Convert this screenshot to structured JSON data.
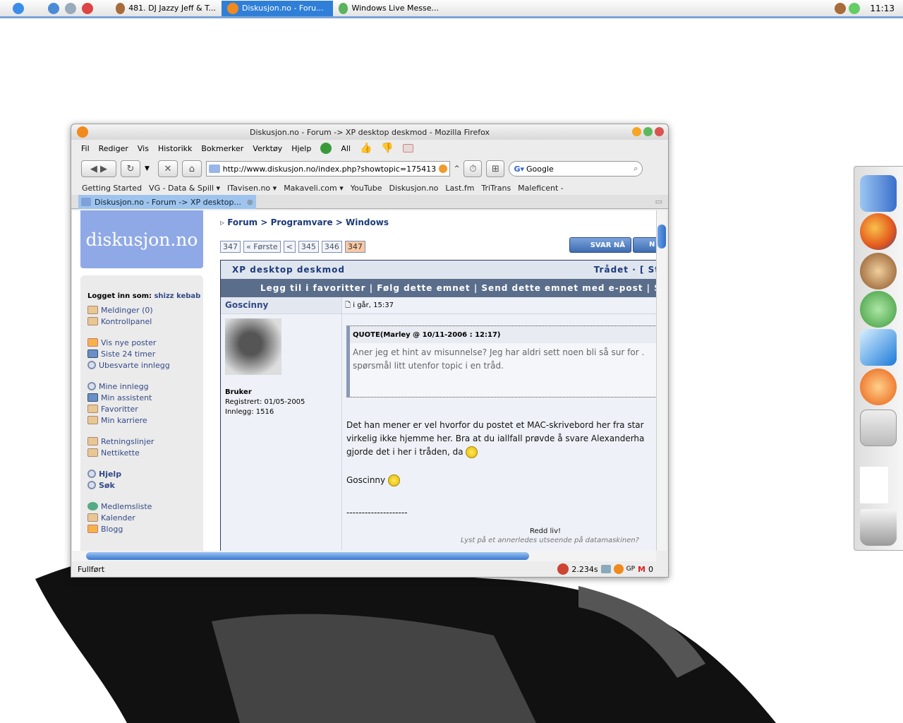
{
  "taskbar": {
    "tasks": [
      {
        "label": "481. DJ Jazzy Jeff & T..."
      },
      {
        "label": "Diskusjon.no - Foru..."
      },
      {
        "label": "Windows Live Messe..."
      }
    ],
    "clock": "11:13"
  },
  "window": {
    "title": "Diskusjon.no - Forum -> XP desktop deskmod - Mozilla Firefox",
    "menu": [
      "Fil",
      "Rediger",
      "Vis",
      "Historikk",
      "Bokmerker",
      "Verktøy",
      "Hjelp"
    ],
    "menu_all": "All",
    "url": "http://www.diskusjon.no/index.php?showtopic=175413",
    "search_placeholder": "Google",
    "bookmarks": [
      "Getting Started",
      "VG - Data & Spill ▾",
      "ITavisen.no ▾",
      "Makaveli.com ▾",
      "YouTube",
      "Diskusjon.no",
      "Last.fm",
      "TriTrans",
      "Maleficent -"
    ],
    "tab_label": "Diskusjon.no - Forum -> XP desktop...",
    "status": "Fullført",
    "status_time": "2.234s",
    "status_gp": "GP",
    "status_mail_count": "0"
  },
  "page": {
    "logo": "diskusjon.no",
    "logged_in_label": "Logget inn som:",
    "logged_in_user": "shizz kebab",
    "side_groups": [
      [
        {
          "label": "Meldinger (0)",
          "icon": "book"
        },
        {
          "label": "Kontrollpanel",
          "icon": "book"
        }
      ],
      [
        {
          "label": "Vis nye poster",
          "icon": "mail"
        },
        {
          "label": "Siste 24 timer",
          "icon": "cal"
        },
        {
          "label": "Ubesvarte innlegg",
          "icon": "mag"
        }
      ],
      [
        {
          "label": "Mine innlegg",
          "icon": "mag"
        },
        {
          "label": "Min assistent",
          "icon": "cal"
        },
        {
          "label": "Favoritter",
          "icon": "book"
        },
        {
          "label": "Min karriere",
          "icon": "book"
        }
      ],
      [
        {
          "label": "Retningslinjer",
          "icon": "book"
        },
        {
          "label": "Nettikette",
          "icon": "book"
        }
      ],
      [
        {
          "label": "Hjelp",
          "icon": "mag",
          "bold": true
        },
        {
          "label": "Søk",
          "icon": "mag",
          "bold": true
        }
      ],
      [
        {
          "label": "Medlemsliste",
          "icon": "users"
        },
        {
          "label": "Kalender",
          "icon": "book"
        },
        {
          "label": "Blogg",
          "icon": "mail"
        }
      ]
    ],
    "breadcrumb": [
      "Forum",
      "Programvare",
      "Windows"
    ],
    "pager": [
      "347",
      "« Første",
      "<",
      "345",
      "346",
      "347"
    ],
    "reply_button": "SVAR NÅ",
    "new_button": "N",
    "thread_title": "XP desktop deskmod",
    "thread_right": "Trådet · [ St",
    "thread_actions": "Legg til i favoritter | Følg dette emnet | Send dette emnet med e-post | Sk",
    "post": {
      "author": "Goscinny",
      "date": "i går, 15:37",
      "rank": "Bruker",
      "registered": "Registrert: 01/05-2005",
      "posts": "Innlegg: 1516",
      "quote_header": "QUOTE(Marley @ 10/11-2006 : 12:17)",
      "quote_lines": [
        "Aner jeg et hint av misunnelse? Jeg har aldri sett noen bli så sur for .",
        "spørsmål litt utenfor topic i en tråd."
      ],
      "body_lines": [
        "Det han mener er vel hvorfor du postet et MAC-skrivebord her fra star",
        "virkelig ikke hjemme her. Bra at du iallfall prøvde å svare Alexanderha",
        "gjorde det i her i tråden, da"
      ],
      "sign": "Goscinny",
      "separator": "--------------------",
      "sig1": "Redd liv!",
      "sig2": "Lyst på et annerledes utseende på datamaskinen?"
    }
  },
  "colors": {
    "accent": "#2f7fd8",
    "forum_blue": "#1c3a7a",
    "thread_bar": "#5a6d8b"
  }
}
